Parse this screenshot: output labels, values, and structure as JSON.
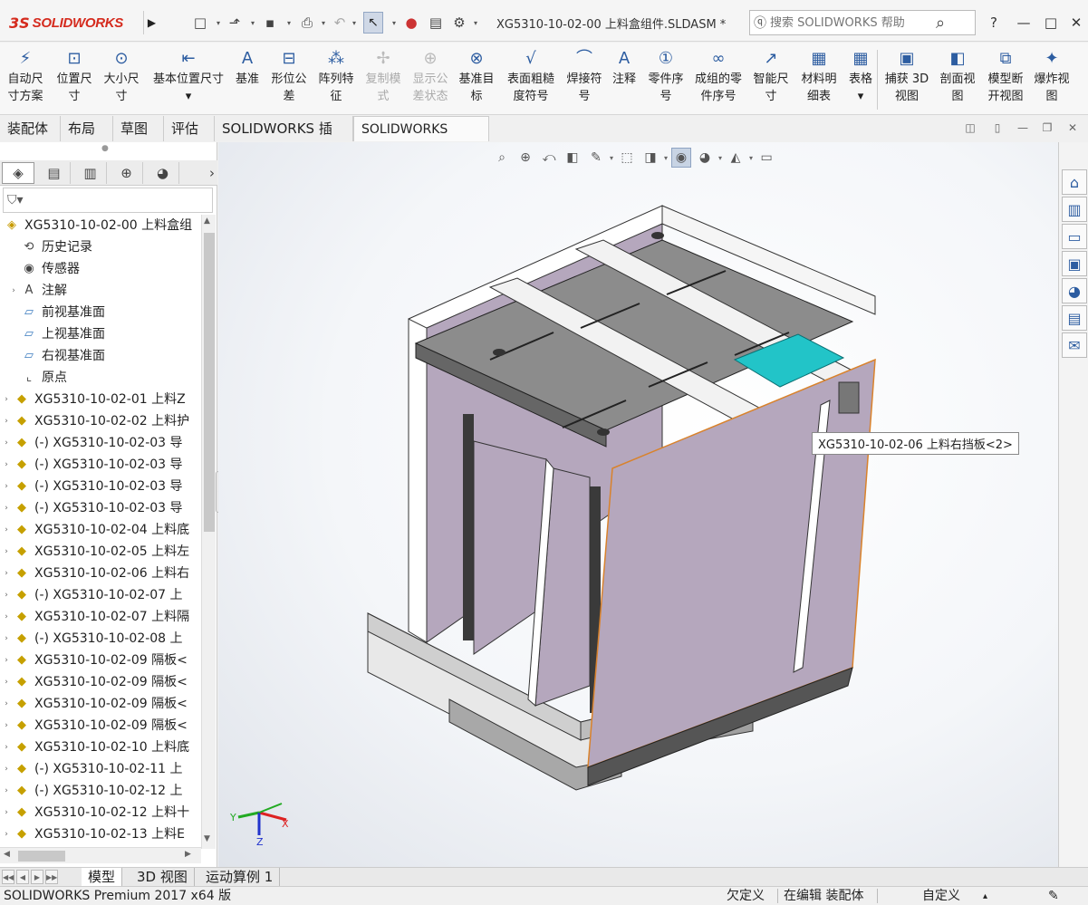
{
  "app": {
    "logo_prefix": "3S",
    "logo_text": "SOLIDWORKS",
    "document_title": "XG5310-10-02-00 上料盒组件.SLDASM *",
    "search_placeholder": "搜索 SOLIDWORKS 帮助",
    "help_label": "?",
    "colors": {
      "accent": "#2d5da1",
      "brand": "#d52b1e",
      "panel_purple": "#b7a8be",
      "selection_cyan": "#22c4c8",
      "plate_grey": "#8f9090"
    }
  },
  "quick_access": [
    {
      "name": "new-document-icon",
      "glyph": "□"
    },
    {
      "name": "open-file-icon",
      "glyph": "⬏"
    },
    {
      "name": "save-icon",
      "glyph": "▪"
    },
    {
      "name": "print-icon",
      "glyph": "⎙"
    },
    {
      "name": "undo-icon",
      "glyph": "↶"
    },
    {
      "name": "select-icon",
      "glyph": "↖"
    },
    {
      "name": "rebuild-traffic-light-icon",
      "glyph": "●"
    },
    {
      "name": "file-properties-icon",
      "glyph": "▤"
    },
    {
      "name": "options-gear-icon",
      "glyph": "⚙"
    }
  ],
  "ribbon": {
    "buttons": [
      {
        "line1": "自动尺",
        "line2": "寸方案",
        "icon": "⚡",
        "enabled": true
      },
      {
        "line1": "位置尺",
        "line2": "寸",
        "icon": "⊡",
        "enabled": true
      },
      {
        "line1": "大小尺",
        "line2": "寸",
        "icon": "⊙",
        "enabled": true
      },
      {
        "line1": "基本位置尺寸",
        "line2": "▾",
        "icon": "⇤",
        "enabled": true
      },
      {
        "line1": "基准",
        "line2": "",
        "icon": "A",
        "enabled": true
      },
      {
        "line1": "形位公",
        "line2": "差",
        "icon": "⊟",
        "enabled": true
      },
      {
        "line1": "阵列特",
        "line2": "征",
        "icon": "⁂",
        "enabled": true
      },
      {
        "line1": "复制模",
        "line2": "式",
        "icon": "✢",
        "enabled": false
      },
      {
        "line1": "显示公",
        "line2": "差状态",
        "icon": "⊕",
        "enabled": false
      },
      {
        "line1": "基准目",
        "line2": "标",
        "icon": "⊗",
        "enabled": true
      },
      {
        "line1": "表面粗糙",
        "line2": "度符号",
        "icon": "√",
        "enabled": true
      },
      {
        "line1": "焊接符",
        "line2": "号",
        "icon": "⌒",
        "enabled": true
      },
      {
        "line1": "注释",
        "line2": "",
        "icon": "A",
        "enabled": true
      },
      {
        "line1": "零件序",
        "line2": "号",
        "icon": "①",
        "enabled": true
      },
      {
        "line1": "成组的零",
        "line2": "件序号",
        "icon": "∞",
        "enabled": true
      },
      {
        "line1": "智能尺",
        "line2": "寸",
        "icon": "↗",
        "enabled": true
      },
      {
        "line1": "材料明",
        "line2": "细表",
        "icon": "▦",
        "enabled": true
      },
      {
        "line1": "表格",
        "line2": "▾",
        "icon": "▦",
        "enabled": true
      },
      {
        "line1": "捕获 3D",
        "line2": "视图",
        "icon": "▣",
        "enabled": true
      },
      {
        "line1": "剖面视",
        "line2": "图",
        "icon": "◧",
        "enabled": true
      },
      {
        "line1": "模型断",
        "line2": "开视图",
        "icon": "⧉",
        "enabled": true
      },
      {
        "line1": "爆炸视",
        "line2": "图",
        "icon": "✦",
        "enabled": true
      }
    ]
  },
  "command_tabs": [
    "装配体",
    "布局",
    "草图",
    "评估",
    "SOLIDWORKS 插件",
    "SOLIDWORKS MBD"
  ],
  "active_command_tab": "SOLIDWORKS MBD",
  "panel_tabs": [
    {
      "name": "featuremanager-tab-icon",
      "glyph": "◈"
    },
    {
      "name": "propertymanager-tab-icon",
      "glyph": "▤"
    },
    {
      "name": "configurationmanager-tab-icon",
      "glyph": "▥"
    },
    {
      "name": "dimxpert-tab-icon",
      "glyph": "⊕"
    },
    {
      "name": "appearance-tab-icon",
      "glyph": "◕"
    }
  ],
  "tree": {
    "root": "XG5310-10-02-00 上料盒组",
    "items": [
      {
        "label": "历史记录",
        "icon": "⟲",
        "type": "gen",
        "expand": false
      },
      {
        "label": "传感器",
        "icon": "◉",
        "type": "gen",
        "expand": false
      },
      {
        "label": "注解",
        "icon": "A",
        "type": "gen",
        "expand": true
      },
      {
        "label": "前视基准面",
        "icon": "▱",
        "type": "plane",
        "expand": false
      },
      {
        "label": "上视基准面",
        "icon": "▱",
        "type": "plane",
        "expand": false
      },
      {
        "label": "右视基准面",
        "icon": "▱",
        "type": "plane",
        "expand": false
      },
      {
        "label": "原点",
        "icon": "⌞",
        "type": "gen",
        "expand": false
      },
      {
        "label": "XG5310-10-02-01 上料Z",
        "icon": "◆",
        "type": "part",
        "expand": true
      },
      {
        "label": "XG5310-10-02-02 上料护",
        "icon": "◆",
        "type": "part",
        "expand": true
      },
      {
        "label": "(-) XG5310-10-02-03 导",
        "icon": "◆",
        "type": "part",
        "expand": true
      },
      {
        "label": "(-) XG5310-10-02-03 导",
        "icon": "◆",
        "type": "part",
        "expand": true
      },
      {
        "label": "(-) XG5310-10-02-03 导",
        "icon": "◆",
        "type": "part",
        "expand": true
      },
      {
        "label": "(-) XG5310-10-02-03 导",
        "icon": "◆",
        "type": "part",
        "expand": true
      },
      {
        "label": "XG5310-10-02-04 上料底",
        "icon": "◆",
        "type": "part",
        "expand": true
      },
      {
        "label": "XG5310-10-02-05 上料左",
        "icon": "◆",
        "type": "part",
        "expand": true
      },
      {
        "label": "XG5310-10-02-06 上料右",
        "icon": "◆",
        "type": "part",
        "expand": true
      },
      {
        "label": "(-) XG5310-10-02-07 上",
        "icon": "◆",
        "type": "part",
        "expand": true
      },
      {
        "label": "XG5310-10-02-07 上料隔",
        "icon": "◆",
        "type": "part",
        "expand": true
      },
      {
        "label": "(-) XG5310-10-02-08 上",
        "icon": "◆",
        "type": "part",
        "expand": true
      },
      {
        "label": "XG5310-10-02-09 隔板<",
        "icon": "◆",
        "type": "part",
        "expand": true
      },
      {
        "label": "XG5310-10-02-09 隔板<",
        "icon": "◆",
        "type": "part",
        "expand": true
      },
      {
        "label": "XG5310-10-02-09 隔板<",
        "icon": "◆",
        "type": "part",
        "expand": true
      },
      {
        "label": "XG5310-10-02-09 隔板<",
        "icon": "◆",
        "type": "part",
        "expand": true
      },
      {
        "label": "XG5310-10-02-10 上料底",
        "icon": "◆",
        "type": "part",
        "expand": true
      },
      {
        "label": "(-) XG5310-10-02-11 上",
        "icon": "◆",
        "type": "part",
        "expand": true
      },
      {
        "label": "(-) XG5310-10-02-12 上",
        "icon": "◆",
        "type": "part",
        "expand": true
      },
      {
        "label": "XG5310-10-02-12 上料十",
        "icon": "◆",
        "type": "part",
        "expand": true
      },
      {
        "label": "XG5310-10-02-13 上料E",
        "icon": "◆",
        "type": "part",
        "expand": true
      }
    ]
  },
  "viewport": {
    "tooltip": "XG5310-10-02-06 上料右挡板<2>",
    "triad": {
      "x": "X",
      "y": "Y",
      "z": "Z"
    },
    "hud": [
      {
        "name": "zoom-to-fit-icon",
        "glyph": "⌕",
        "on": false
      },
      {
        "name": "zoom-to-area-icon",
        "glyph": "⊕",
        "on": false
      },
      {
        "name": "previous-view-icon",
        "glyph": "⤺",
        "on": false
      },
      {
        "name": "section-view-icon",
        "glyph": "◧",
        "on": false
      },
      {
        "name": "dynamic-annotation-icon",
        "glyph": "✎",
        "on": false
      },
      {
        "name": "view-orientation-icon",
        "glyph": "⬚",
        "on": false
      },
      {
        "name": "display-style-icon",
        "glyph": "◨",
        "on": false
      },
      {
        "name": "hide-show-items-icon",
        "glyph": "◉",
        "on": true
      },
      {
        "name": "edit-appearance-icon",
        "glyph": "◕",
        "on": false
      },
      {
        "name": "apply-scene-icon",
        "glyph": "◭",
        "on": false
      },
      {
        "name": "view-settings-icon",
        "glyph": "▭",
        "on": false
      }
    ]
  },
  "task_pane": [
    {
      "name": "solidworks-resources-icon",
      "glyph": "⌂"
    },
    {
      "name": "design-library-icon",
      "glyph": "▥"
    },
    {
      "name": "file-explorer-icon",
      "glyph": "▭"
    },
    {
      "name": "view-palette-icon",
      "glyph": "▣"
    },
    {
      "name": "appearances-scenes-icon",
      "glyph": "◕"
    },
    {
      "name": "custom-properties-icon",
      "glyph": "▤"
    },
    {
      "name": "solidworks-forum-icon",
      "glyph": "✉"
    }
  ],
  "bottom_tabs": [
    "模型",
    "3D 视图",
    "运动算例 1"
  ],
  "active_bottom_tab": "模型",
  "status": {
    "product": "SOLIDWORKS Premium 2017 x64 版",
    "defined": "欠定义",
    "editing": "在编辑 装配体",
    "units": "自定义"
  }
}
